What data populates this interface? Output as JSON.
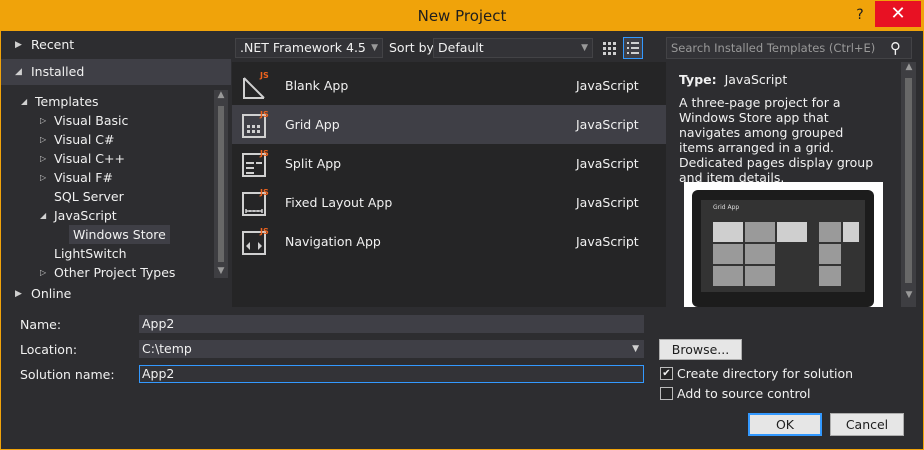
{
  "window": {
    "title": "New Project",
    "help_glyph": "?",
    "close_glyph": "✕"
  },
  "left": {
    "recent": "Recent",
    "installed": "Installed",
    "online": "Online",
    "tree": [
      {
        "label": "Templates",
        "level": 0,
        "expanded": true
      },
      {
        "label": "Visual Basic",
        "level": 1,
        "expanded": false
      },
      {
        "label": "Visual C#",
        "level": 1,
        "expanded": false
      },
      {
        "label": "Visual C++",
        "level": 1,
        "expanded": false
      },
      {
        "label": "Visual F#",
        "level": 1,
        "expanded": false
      },
      {
        "label": "SQL Server",
        "level": 1,
        "expanded": null
      },
      {
        "label": "JavaScript",
        "level": 1,
        "expanded": true
      },
      {
        "label": "Windows Store",
        "level": 2,
        "selected": true
      },
      {
        "label": "LightSwitch",
        "level": 1,
        "expanded": null
      },
      {
        "label": "Other Project Types",
        "level": 1,
        "expanded": false
      }
    ]
  },
  "toolbar": {
    "framework": ".NET Framework 4.5",
    "sort_label": "Sort by:",
    "sort_value": "Default",
    "search_placeholder": "Search Installed Templates (Ctrl+E)"
  },
  "templates": [
    {
      "name": "Blank App",
      "language": "JavaScript",
      "selected": false,
      "icon": "blank-app-icon"
    },
    {
      "name": "Grid App",
      "language": "JavaScript",
      "selected": true,
      "icon": "grid-app-icon"
    },
    {
      "name": "Split App",
      "language": "JavaScript",
      "selected": false,
      "icon": "split-app-icon"
    },
    {
      "name": "Fixed Layout App",
      "language": "JavaScript",
      "selected": false,
      "icon": "fixed-layout-app-icon"
    },
    {
      "name": "Navigation App",
      "language": "JavaScript",
      "selected": false,
      "icon": "navigation-app-icon"
    }
  ],
  "details": {
    "type_label": "Type:",
    "type_value": "JavaScript",
    "description": "A three-page project for a Windows Store app that navigates among grouped items arranged in a grid. Dedicated pages display group and item details.",
    "preview_title": "Grid App"
  },
  "form": {
    "name_label": "Name:",
    "name_value": "App2",
    "location_label": "Location:",
    "location_value": "C:\\temp",
    "solution_label": "Solution name:",
    "solution_value": "App2",
    "browse": "Browse...",
    "create_dir": "Create directory for solution",
    "create_dir_checked": true,
    "add_source": "Add to source control",
    "add_source_checked": false,
    "ok": "OK",
    "cancel": "Cancel"
  },
  "colors": {
    "accent": "#f0a30a",
    "selection": "#3399ff",
    "js_badge": "#f0641e"
  }
}
